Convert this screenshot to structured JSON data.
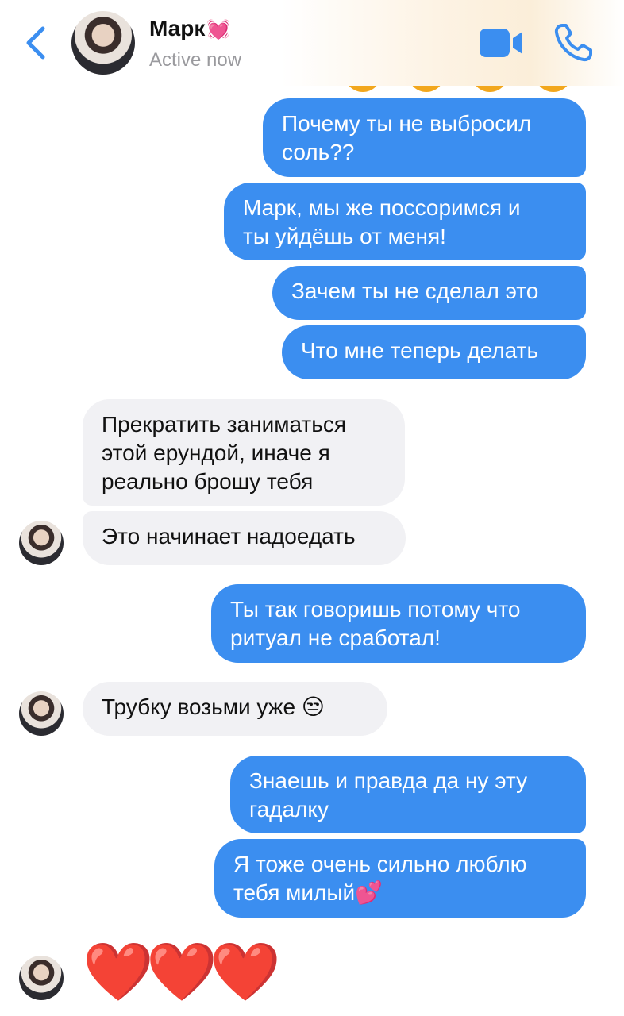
{
  "header": {
    "name": "Марк",
    "name_emoji": "💓",
    "status": "Active now",
    "icons": {
      "back": "chevron-left-icon",
      "video": "video-camera-icon",
      "call": "phone-icon"
    },
    "accent_color": "#3b8ef0"
  },
  "messages": [
    {
      "side": "out",
      "text": "Почему ты не выбросил\nсоль??"
    },
    {
      "side": "out",
      "text": "Марк, мы же поссоримся и\nты уйдёшь от меня!"
    },
    {
      "side": "out",
      "text": "Зачем ты не сделал это"
    },
    {
      "side": "out",
      "text": "Что мне теперь делать"
    },
    {
      "side": "in",
      "text": "Прекратить заниматься\nэтой ерундой, иначе я\nреально брошу тебя"
    },
    {
      "side": "in",
      "text": "Это начинает надоедать"
    },
    {
      "side": "out",
      "text": "Ты так говоришь потому что\nритуал не сработал!"
    },
    {
      "side": "in",
      "text": "Трубку возьми уже 😒"
    },
    {
      "side": "out",
      "text": "Знаешь и правда да ну эту\nгадалку"
    },
    {
      "side": "out",
      "text": "Я тоже очень сильно люблю\nтебя милый💕"
    },
    {
      "side": "in",
      "text": "❤️❤️❤️"
    }
  ],
  "big_hearts": [
    "❤️",
    "❤️",
    "❤️"
  ]
}
